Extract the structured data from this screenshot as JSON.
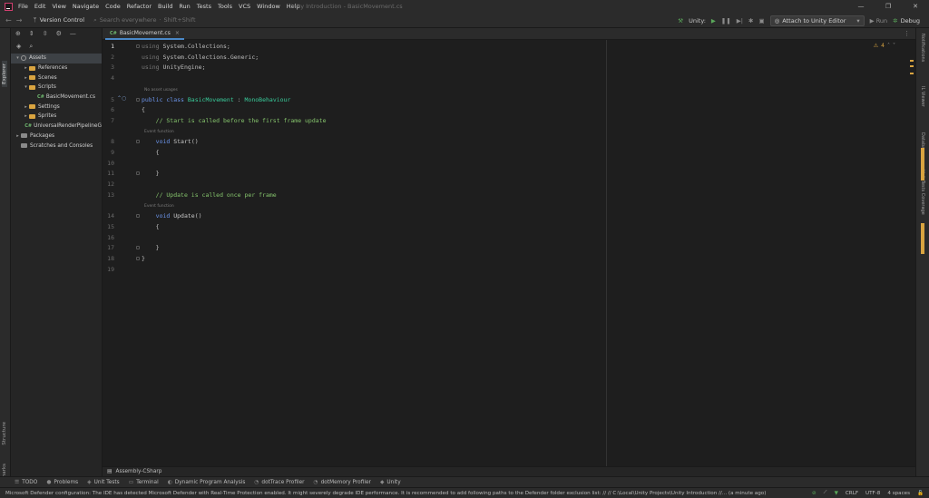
{
  "window": {
    "title": "Unity Introduction - BasicMovement.cs"
  },
  "menu": [
    "File",
    "Edit",
    "View",
    "Navigate",
    "Code",
    "Refactor",
    "Build",
    "Run",
    "Tests",
    "Tools",
    "VCS",
    "Window",
    "Help"
  ],
  "toolbar": {
    "version_control": "Version Control",
    "search": "Search everywhere",
    "search_shortcut": "Shift+Shift",
    "unity_label": "Unity:",
    "attach": "Attach to Unity Editor",
    "run": "Run",
    "debug": "Debug"
  },
  "left_stripe": {
    "explorer": "Explorer",
    "structure": "Structure",
    "bookmarks": "Bookmarks"
  },
  "explorer": {
    "tree": [
      {
        "label": "Assets",
        "depth": 0,
        "arrow": "▾",
        "icon": "asset",
        "selected": true
      },
      {
        "label": "References",
        "depth": 1,
        "arrow": "▸",
        "icon": "folder"
      },
      {
        "label": "Scenes",
        "depth": 1,
        "arrow": "▸",
        "icon": "folder"
      },
      {
        "label": "Scripts",
        "depth": 1,
        "arrow": "▾",
        "icon": "folder"
      },
      {
        "label": "BasicMovement.cs",
        "depth": 2,
        "arrow": "",
        "icon": "cs"
      },
      {
        "label": "Settings",
        "depth": 1,
        "arrow": "▸",
        "icon": "folder"
      },
      {
        "label": "Sprites",
        "depth": 1,
        "arrow": "▸",
        "icon": "folder"
      },
      {
        "label": "UniversalRenderPipelineG",
        "depth": 1,
        "arrow": "",
        "icon": "cs"
      },
      {
        "label": "Packages",
        "depth": 0,
        "arrow": "▸",
        "icon": "folder-grey"
      },
      {
        "label": "Scratches and Consoles",
        "depth": 0,
        "arrow": "",
        "icon": "grey"
      }
    ]
  },
  "editor": {
    "tab": {
      "icon": "C#",
      "label": "BasicMovement.cs"
    },
    "warnings": "4",
    "lines": [
      {
        "n": "1",
        "html": "<span class=\"dim\">using</span> System.Collections;"
      },
      {
        "n": "2",
        "html": "<span class=\"dim\">using</span> System.Collections.Generic;"
      },
      {
        "n": "3",
        "html": "<span class=\"dim\">using</span> UnityEngine;"
      },
      {
        "n": "4",
        "html": ""
      },
      {
        "n": "5",
        "html": "<span class=\"kw\">public class</span> <span class=\"cls\">BasicMovement</span> : <span class=\"base\">MonoBehaviour</span>",
        "hint": "No asset usages"
      },
      {
        "n": "6",
        "html": "{"
      },
      {
        "n": "7",
        "html": "    <span class=\"cmt\">// Start is called before the first frame update</span>"
      },
      {
        "n": "8",
        "html": "    <span class=\"kw\">void</span> <span class=\"fn\">Start</span>()",
        "hint": "Event function"
      },
      {
        "n": "9",
        "html": "    {"
      },
      {
        "n": "10",
        "html": ""
      },
      {
        "n": "11",
        "html": "    }"
      },
      {
        "n": "12",
        "html": ""
      },
      {
        "n": "13",
        "html": "    <span class=\"cmt\">// Update is called once per frame</span>"
      },
      {
        "n": "14",
        "html": "    <span class=\"kw\">void</span> <span class=\"fn\">Update</span>()",
        "hint": "Event function"
      },
      {
        "n": "15",
        "html": "    {"
      },
      {
        "n": "16",
        "html": ""
      },
      {
        "n": "17",
        "html": "    }"
      },
      {
        "n": "18",
        "html": "}"
      },
      {
        "n": "19",
        "html": ""
      }
    ]
  },
  "right_stripe": [
    "Notifications",
    "IL Viewer",
    "Database",
    "Unit Tests Coverage"
  ],
  "nav_bar": {
    "label": "Assembly-CSharp"
  },
  "bottom_tabs": [
    "TODO",
    "Problems",
    "Unit Tests",
    "Terminal",
    "Dynamic Program Analysis",
    "dotTrace Profiler",
    "dotMemory Profiler",
    "Unity"
  ],
  "status": {
    "message": "Microsoft Defender configuration: The IDE has detected Microsoft Defender with Real-Time Protection enabled. It might severely degrade IDE performance. It is recommended to add following paths to the Defender folder exclusion list: // //  C:\\Local\\Unity Projects\\Unity Introduction //... (a minute ago)",
    "line_ending": "CRLF",
    "encoding": "UTF-8",
    "indent": "4 spaces"
  },
  "colors": {
    "accent": "#4a88c7",
    "warning": "#d9a440",
    "comment": "#85c46c",
    "keyword": "#6c95eb",
    "type": "#39cc9b"
  }
}
